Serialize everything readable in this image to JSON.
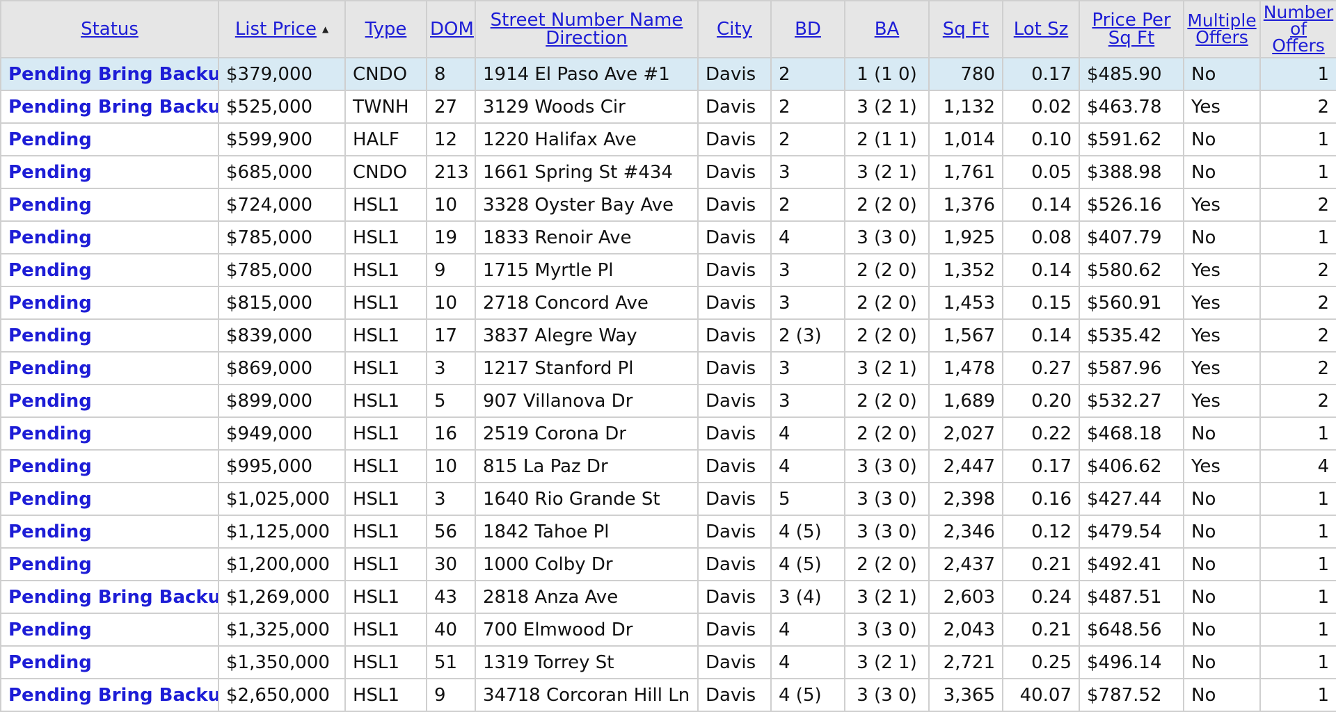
{
  "columns": {
    "status": "Status",
    "list_price": "List Price",
    "type": "Type",
    "dom": "DOM",
    "street": "Street Number Name Direction",
    "city": "City",
    "bd": "BD",
    "ba": "BA",
    "sqft": "Sq Ft",
    "lot": "Lot Sz",
    "ppsf": "Price Per Sq Ft",
    "multi": "Multiple Offers",
    "num_offers": "Number of Offers"
  },
  "sort_indicator": "▲",
  "rows": [
    {
      "status": "Pending Bring Backup",
      "price": "$379,000",
      "type": "CNDO",
      "dom": "8",
      "street": "1914 El Paso Ave #1",
      "city": "Davis",
      "bd": "2",
      "ba": "1 (1 0)",
      "sqft": "780",
      "lot": "0.17",
      "ppsf": "$485.90",
      "multi": "No",
      "offers": "1"
    },
    {
      "status": "Pending Bring Backup",
      "price": "$525,000",
      "type": "TWNH",
      "dom": "27",
      "street": "3129 Woods Cir",
      "city": "Davis",
      "bd": "2",
      "ba": "3 (2 1)",
      "sqft": "1,132",
      "lot": "0.02",
      "ppsf": "$463.78",
      "multi": "Yes",
      "offers": "2"
    },
    {
      "status": "Pending",
      "price": "$599,900",
      "type": "HALF",
      "dom": "12",
      "street": "1220 Halifax Ave",
      "city": "Davis",
      "bd": "2",
      "ba": "2 (1 1)",
      "sqft": "1,014",
      "lot": "0.10",
      "ppsf": "$591.62",
      "multi": "No",
      "offers": "1"
    },
    {
      "status": "Pending",
      "price": "$685,000",
      "type": "CNDO",
      "dom": "213",
      "street": "1661 Spring St #434",
      "city": "Davis",
      "bd": "3",
      "ba": "3 (2 1)",
      "sqft": "1,761",
      "lot": "0.05",
      "ppsf": "$388.98",
      "multi": "No",
      "offers": "1"
    },
    {
      "status": "Pending",
      "price": "$724,000",
      "type": "HSL1",
      "dom": "10",
      "street": "3328 Oyster Bay Ave",
      "city": "Davis",
      "bd": "2",
      "ba": "2 (2 0)",
      "sqft": "1,376",
      "lot": "0.14",
      "ppsf": "$526.16",
      "multi": "Yes",
      "offers": "2"
    },
    {
      "status": "Pending",
      "price": "$785,000",
      "type": "HSL1",
      "dom": "19",
      "street": "1833 Renoir Ave",
      "city": "Davis",
      "bd": "4",
      "ba": "3 (3 0)",
      "sqft": "1,925",
      "lot": "0.08",
      "ppsf": "$407.79",
      "multi": "No",
      "offers": "1"
    },
    {
      "status": "Pending",
      "price": "$785,000",
      "type": "HSL1",
      "dom": "9",
      "street": "1715 Myrtle Pl",
      "city": "Davis",
      "bd": "3",
      "ba": "2 (2 0)",
      "sqft": "1,352",
      "lot": "0.14",
      "ppsf": "$580.62",
      "multi": "Yes",
      "offers": "2"
    },
    {
      "status": "Pending",
      "price": "$815,000",
      "type": "HSL1",
      "dom": "10",
      "street": "2718 Concord Ave",
      "city": "Davis",
      "bd": "3",
      "ba": "2 (2 0)",
      "sqft": "1,453",
      "lot": "0.15",
      "ppsf": "$560.91",
      "multi": "Yes",
      "offers": "2"
    },
    {
      "status": "Pending",
      "price": "$839,000",
      "type": "HSL1",
      "dom": "17",
      "street": "3837 Alegre Way",
      "city": "Davis",
      "bd": "2 (3)",
      "ba": "2 (2 0)",
      "sqft": "1,567",
      "lot": "0.14",
      "ppsf": "$535.42",
      "multi": "Yes",
      "offers": "2"
    },
    {
      "status": "Pending",
      "price": "$869,000",
      "type": "HSL1",
      "dom": "3",
      "street": "1217 Stanford Pl",
      "city": "Davis",
      "bd": "3",
      "ba": "3 (2 1)",
      "sqft": "1,478",
      "lot": "0.27",
      "ppsf": "$587.96",
      "multi": "Yes",
      "offers": "2"
    },
    {
      "status": "Pending",
      "price": "$899,000",
      "type": "HSL1",
      "dom": "5",
      "street": "907 Villanova Dr",
      "city": "Davis",
      "bd": "3",
      "ba": "2 (2 0)",
      "sqft": "1,689",
      "lot": "0.20",
      "ppsf": "$532.27",
      "multi": "Yes",
      "offers": "2"
    },
    {
      "status": "Pending",
      "price": "$949,000",
      "type": "HSL1",
      "dom": "16",
      "street": "2519 Corona Dr",
      "city": "Davis",
      "bd": "4",
      "ba": "2 (2 0)",
      "sqft": "2,027",
      "lot": "0.22",
      "ppsf": "$468.18",
      "multi": "No",
      "offers": "1"
    },
    {
      "status": "Pending",
      "price": "$995,000",
      "type": "HSL1",
      "dom": "10",
      "street": "815 La Paz Dr",
      "city": "Davis",
      "bd": "4",
      "ba": "3 (3 0)",
      "sqft": "2,447",
      "lot": "0.17",
      "ppsf": "$406.62",
      "multi": "Yes",
      "offers": "4"
    },
    {
      "status": "Pending",
      "price": "$1,025,000",
      "type": "HSL1",
      "dom": "3",
      "street": "1640 Rio Grande St",
      "city": "Davis",
      "bd": "5",
      "ba": "3 (3 0)",
      "sqft": "2,398",
      "lot": "0.16",
      "ppsf": "$427.44",
      "multi": "No",
      "offers": "1"
    },
    {
      "status": "Pending",
      "price": "$1,125,000",
      "type": "HSL1",
      "dom": "56",
      "street": "1842 Tahoe Pl",
      "city": "Davis",
      "bd": "4 (5)",
      "ba": "3 (3 0)",
      "sqft": "2,346",
      "lot": "0.12",
      "ppsf": "$479.54",
      "multi": "No",
      "offers": "1"
    },
    {
      "status": "Pending",
      "price": "$1,200,000",
      "type": "HSL1",
      "dom": "30",
      "street": "1000 Colby Dr",
      "city": "Davis",
      "bd": "4 (5)",
      "ba": "2 (2 0)",
      "sqft": "2,437",
      "lot": "0.21",
      "ppsf": "$492.41",
      "multi": "No",
      "offers": "1"
    },
    {
      "status": "Pending Bring Backup",
      "price": "$1,269,000",
      "type": "HSL1",
      "dom": "43",
      "street": "2818 Anza Ave",
      "city": "Davis",
      "bd": "3 (4)",
      "ba": "3 (2 1)",
      "sqft": "2,603",
      "lot": "0.24",
      "ppsf": "$487.51",
      "multi": "No",
      "offers": "1"
    },
    {
      "status": "Pending",
      "price": "$1,325,000",
      "type": "HSL1",
      "dom": "40",
      "street": "700 Elmwood Dr",
      "city": "Davis",
      "bd": "4",
      "ba": "3 (3 0)",
      "sqft": "2,043",
      "lot": "0.21",
      "ppsf": "$648.56",
      "multi": "No",
      "offers": "1"
    },
    {
      "status": "Pending",
      "price": "$1,350,000",
      "type": "HSL1",
      "dom": "51",
      "street": "1319 Torrey St",
      "city": "Davis",
      "bd": "4",
      "ba": "3 (2 1)",
      "sqft": "2,721",
      "lot": "0.25",
      "ppsf": "$496.14",
      "multi": "No",
      "offers": "1"
    },
    {
      "status": "Pending Bring Backup",
      "price": "$2,650,000",
      "type": "HSL1",
      "dom": "9",
      "street": "34718 Corcoran Hill Ln",
      "city": "Davis",
      "bd": "4 (5)",
      "ba": "3 (3 0)",
      "sqft": "3,365",
      "lot": "40.07",
      "ppsf": "$787.52",
      "multi": "No",
      "offers": "1"
    }
  ]
}
